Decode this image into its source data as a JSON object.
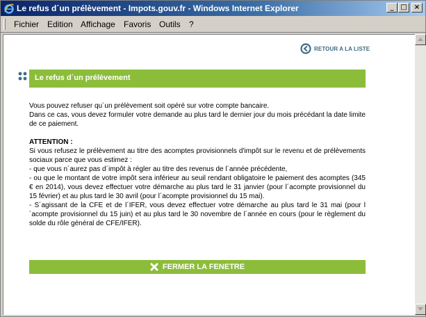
{
  "window": {
    "title": "Le refus d´un prélèvement - Impots.gouv.fr - Windows Internet Explorer",
    "minimize": "_",
    "maximize": "□",
    "close": "×"
  },
  "menu": {
    "items": [
      "Fichier",
      "Edition",
      "Affichage",
      "Favoris",
      "Outils",
      "?"
    ]
  },
  "page": {
    "back_link": "RETOUR A LA LISTE",
    "section_title": "Le refus d´un prélèvement",
    "intro": [
      "Vous pouvez refuser qu´un prélèvement soit opéré sur votre compte bancaire.",
      "Dans ce cas, vous devez formuler votre demande au plus tard le dernier jour du mois précédant la date limite de ce paiement."
    ],
    "attention_label": "ATTENTION :",
    "attention_paragraphs": [
      "Si vous refusez le prélèvement au titre des acomptes provisionnels d'impôt sur le revenu et de prélèvements sociaux parce que vous estimez :",
      "- que vous n´aurez pas d´impôt à régler au titre des revenus de l´année précédente,",
      "- ou que le montant de votre impôt sera inférieur au seuil rendant obligatoire le paiement des acomptes (345 € en 2014), vous devez effectuer votre démarche au plus tard le 31 janvier (pour l´acompte provisionnel du 15 février) et au plus tard le 30 avril (pour l´acompte provisionnel du 15 mai).",
      "- S´agissant de la CFE et de l´IFER, vous devez effectuer votre démarche au plus tard le 31 mai (pour l´acompte provisionnel du 15 juin) et au plus tard le 30 novembre de l´année en cours (pour le règlement du solde du rôle général de CFE/IFER)."
    ],
    "close_button": "FERMER LA FENETRE"
  },
  "colors": {
    "accent_green": "#8cbd3a",
    "link_blue": "#3d6a84",
    "titlebar_start": "#0a246a"
  }
}
